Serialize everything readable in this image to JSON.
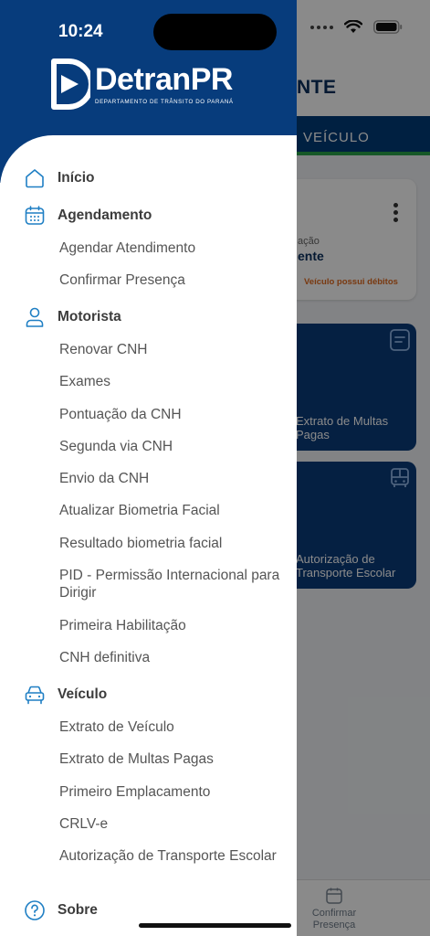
{
  "status_bar": {
    "time": "10:24"
  },
  "logo": {
    "name": "DetranPR",
    "subtitle": "DEPARTAMENTO DE TRÂNSITO DO PARANÁ"
  },
  "menu": {
    "inicio": {
      "label": "Início",
      "icon": "home-icon"
    },
    "agendamento": {
      "label": "Agendamento",
      "icon": "calendar-icon",
      "items": [
        "Agendar Atendimento",
        "Confirmar Presença"
      ]
    },
    "motorista": {
      "label": "Motorista",
      "icon": "user-icon",
      "items": [
        "Renovar CNH",
        "Exames",
        "Pontuação da CNH",
        "Segunda via CNH",
        "Envio da CNH",
        "Atualizar Biometria Facial",
        "Resultado biometria facial",
        "PID - Permissão Internacional para Dirigir",
        "Primeira Habilitação",
        "CNH definitiva"
      ]
    },
    "veiculo": {
      "label": "Veículo",
      "icon": "car-icon",
      "items": [
        "Extrato de Veículo",
        "Extrato de Multas Pagas",
        "Primeiro Emplacamento",
        "CRLV-e",
        "Autorização de Transporte Escolar"
      ]
    },
    "sobre": {
      "label": "Sobre",
      "icon": "help-icon"
    }
  },
  "background": {
    "title_fragment": "NTE",
    "tab_label": "VEÍCULO",
    "card": {
      "label": "ação",
      "value": "ente",
      "alert": "Veículo possui débitos"
    },
    "tiles": [
      "Extrato de Multas Pagas",
      "Autorização de Transporte Escolar"
    ],
    "bottom_nav_item": "Confirmar Presença"
  },
  "colors": {
    "brand_blue": "#073c7c",
    "accent_green": "#2aa34a",
    "icon_blue": "#1f7fc4",
    "alert_orange": "#e06a1f"
  }
}
